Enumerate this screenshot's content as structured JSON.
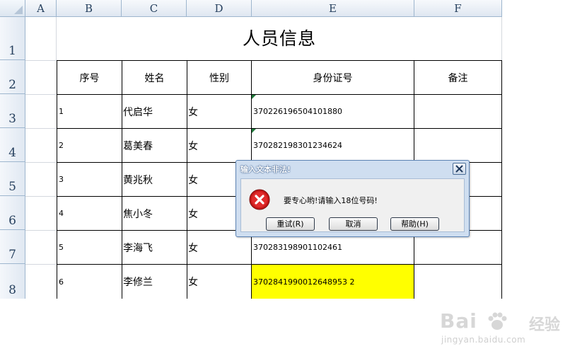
{
  "columns": [
    "A",
    "B",
    "C",
    "D",
    "E",
    "F"
  ],
  "rows": [
    "1",
    "2",
    "3",
    "4",
    "5",
    "6",
    "7",
    "8"
  ],
  "title": "人员信息",
  "headers": {
    "seq": "序号",
    "name": "姓名",
    "gender": "性别",
    "id": "身份证号",
    "note": "备注"
  },
  "records": [
    {
      "seq": "1",
      "name": "代启华",
      "gender": "女",
      "id": "370226196504101880"
    },
    {
      "seq": "2",
      "name": "葛美春",
      "gender": "女",
      "id": "370282198301234624"
    },
    {
      "seq": "3",
      "name": "黄兆秋",
      "gender": "女",
      "id": ""
    },
    {
      "seq": "4",
      "name": "焦小冬",
      "gender": "女",
      "id": ""
    },
    {
      "seq": "5",
      "name": "李海飞",
      "gender": "女",
      "id": "370283198901102461"
    },
    {
      "seq": "6",
      "name": "李修兰",
      "gender": "女",
      "id": "3702841990012648953 2"
    }
  ],
  "highlight_color": "#ffff00",
  "dialog": {
    "title": "输入文本非法!",
    "message": "要专心哟!请输入18位号码!",
    "icon": "error-icon",
    "buttons": {
      "retry": "重试(R)",
      "cancel": "取消",
      "help": "帮助(H)"
    }
  },
  "watermark": {
    "brand": "Bai",
    "brand_suffix": "经验",
    "url": "jingyan.baidu.com"
  }
}
